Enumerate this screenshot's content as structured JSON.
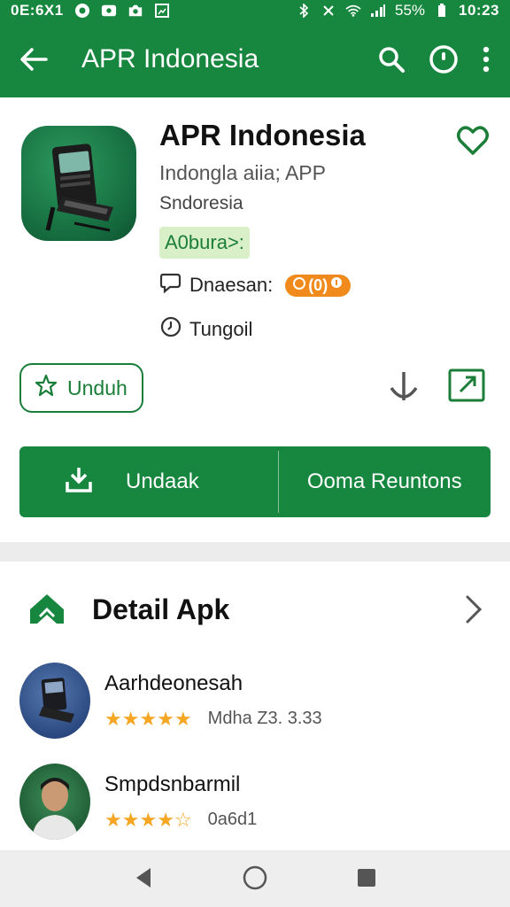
{
  "status_bar": {
    "time_left": "0E:6X1",
    "battery": "55%",
    "time_right": "10:23"
  },
  "app_bar": {
    "title": "APR Indonesia",
    "icons": [
      "back-arrow-icon",
      "search-icon",
      "info-icon",
      "more-vert-icon"
    ]
  },
  "app_info": {
    "name": "APR Indonesia",
    "developer": "Indongla aiia; APP",
    "subtitle": "Sndoresia",
    "tag": "A0bura>:",
    "row1_label": "Dnaesan:",
    "row1_badge": "(0)",
    "row2_label": "Tungoil",
    "outline_button": "Unduh",
    "big_button_left": "Undaak",
    "big_button_right": "Ooma Reuntons",
    "colors": {
      "primary": "#17863e",
      "tag_bg": "#d9efc7",
      "badge": "#f08a1c"
    }
  },
  "details": {
    "title": "Detail Apk",
    "items": [
      {
        "name": "Aarhdeonesah",
        "rating": 4.5,
        "meta": "Mdha Z3. 3.33"
      },
      {
        "name": "Smpdsnbarmil",
        "rating": 4.0,
        "meta": "0a6d1"
      }
    ]
  },
  "nav_bar": {
    "icons": [
      "back-triangle-icon",
      "home-circle-icon",
      "recents-square-icon"
    ]
  }
}
